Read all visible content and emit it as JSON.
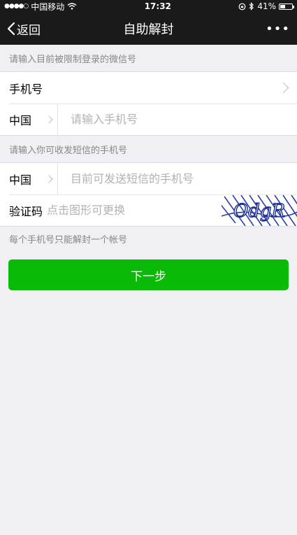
{
  "status_bar": {
    "signal_dots": "●●●●○",
    "carrier": "中国移动",
    "time": "17:32",
    "battery": "41%",
    "battery_level": 0.41
  },
  "nav": {
    "back_label": "返回",
    "title": "自助解封",
    "more_label": "•••"
  },
  "section1": {
    "hint": "请输入目前被限制登录的微信号",
    "account_type_label": "手机号",
    "country": "中国",
    "phone_placeholder": "请输入手机号"
  },
  "section2": {
    "hint": "请输入你可收发短信的手机号",
    "country": "中国",
    "phone_placeholder": "目前可发送短信的手机号",
    "captcha_label": "验证码",
    "captcha_placeholder": "点击图形可更换",
    "captcha_text": "OdgR"
  },
  "note": "每个手机号只能解封一个帐号",
  "next_button": "下一步",
  "colors": {
    "primary_button": "#09bb07",
    "nav_background": "#1a1a1a",
    "page_background": "#efeff4"
  }
}
